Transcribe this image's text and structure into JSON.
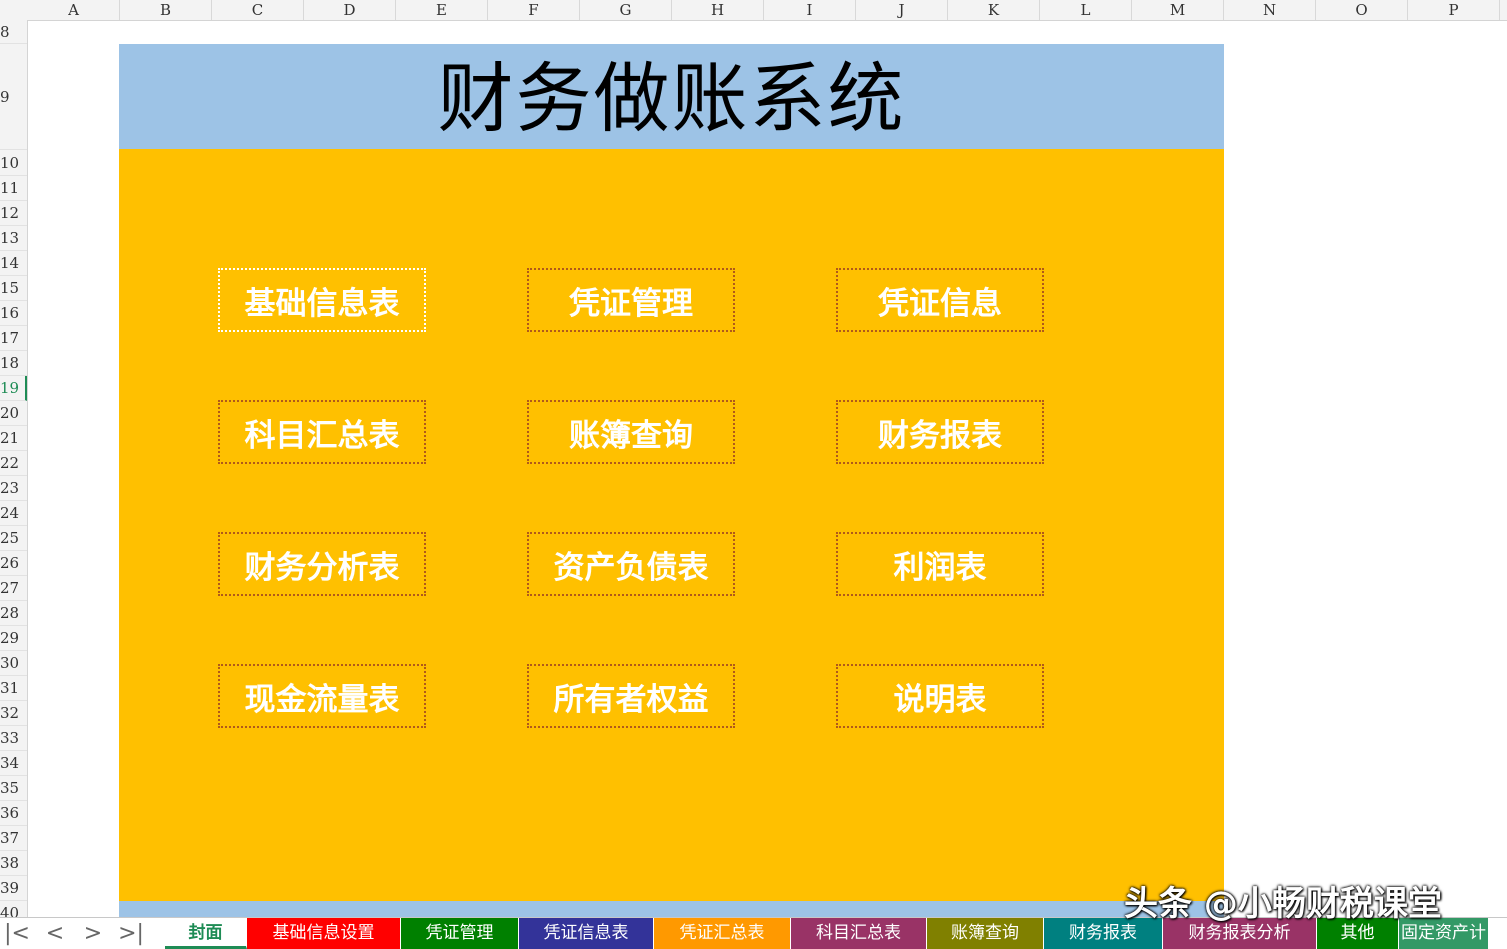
{
  "columns": [
    "A",
    "B",
    "C",
    "D",
    "E",
    "F",
    "G",
    "H",
    "I",
    "J",
    "K",
    "L",
    "M",
    "N",
    "O",
    "P"
  ],
  "rows": [
    "8",
    "9",
    "10",
    "11",
    "12",
    "13",
    "14",
    "15",
    "16",
    "17",
    "18",
    "19",
    "20",
    "21",
    "22",
    "23",
    "24",
    "25",
    "26",
    "27",
    "28",
    "29",
    "30",
    "31",
    "32",
    "33",
    "34",
    "35",
    "36",
    "37",
    "38",
    "39",
    "40"
  ],
  "active_row": "19",
  "title": "财务做账系统",
  "menu": [
    {
      "label": "基础信息表"
    },
    {
      "label": "凭证管理"
    },
    {
      "label": "凭证信息"
    },
    {
      "label": "科目汇总表"
    },
    {
      "label": "账簿查询"
    },
    {
      "label": "财务报表"
    },
    {
      "label": "财务分析表"
    },
    {
      "label": "资产负债表"
    },
    {
      "label": "利润表"
    },
    {
      "label": "现金流量表"
    },
    {
      "label": "所有者权益"
    },
    {
      "label": "说明表"
    }
  ],
  "tabs": [
    {
      "label": "封面",
      "color": "#ffffff",
      "active": true
    },
    {
      "label": "基础信息设置",
      "color": "#ff0000"
    },
    {
      "label": "凭证管理",
      "color": "#008000"
    },
    {
      "label": "凭证信息表",
      "color": "#333399"
    },
    {
      "label": "凭证汇总表",
      "color": "#ff9900"
    },
    {
      "label": "科目汇总表",
      "color": "#993366"
    },
    {
      "label": "账簿查询",
      "color": "#808000"
    },
    {
      "label": "财务报表",
      "color": "#008080"
    },
    {
      "label": "财务报表分析",
      "color": "#993366"
    },
    {
      "label": "其他",
      "color": "#008000"
    },
    {
      "label": "固定资产计",
      "color": "#339966"
    }
  ],
  "nav": {
    "first": "|<",
    "prev": "<",
    "next": ">",
    "last": ">|"
  },
  "watermark": "头条 @小畅财税课堂",
  "colors": {
    "title_band": "#9dc3e6",
    "panel": "#ffc000",
    "active_accent": "#1e8c55"
  }
}
